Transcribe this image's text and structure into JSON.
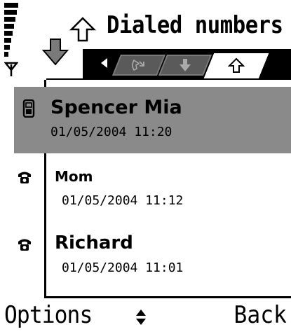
{
  "header": {
    "title": "Dialed numbers"
  },
  "tabs": [
    {
      "icon": "missed-call-icon",
      "active": false
    },
    {
      "icon": "received-call-icon",
      "active": false
    },
    {
      "icon": "dialed-call-icon",
      "active": true
    }
  ],
  "list": {
    "items": [
      {
        "name": "Spencer Mia",
        "time": "01/05/2004 11:20",
        "icon": "mobile-phone-icon",
        "selected": true
      },
      {
        "name": "Mom",
        "time": "01/05/2004 11:12",
        "icon": "phone-handset-icon",
        "selected": false
      },
      {
        "name": "Richard",
        "time": "01/05/2004 11:01",
        "icon": "phone-handset-icon",
        "selected": false
      }
    ]
  },
  "softkeys": {
    "left": "Options",
    "right": "Back"
  },
  "colors": {
    "selection": "#8a8a8a",
    "tab_bar": "#000000",
    "inactive_tab": "#5a5a5a"
  }
}
